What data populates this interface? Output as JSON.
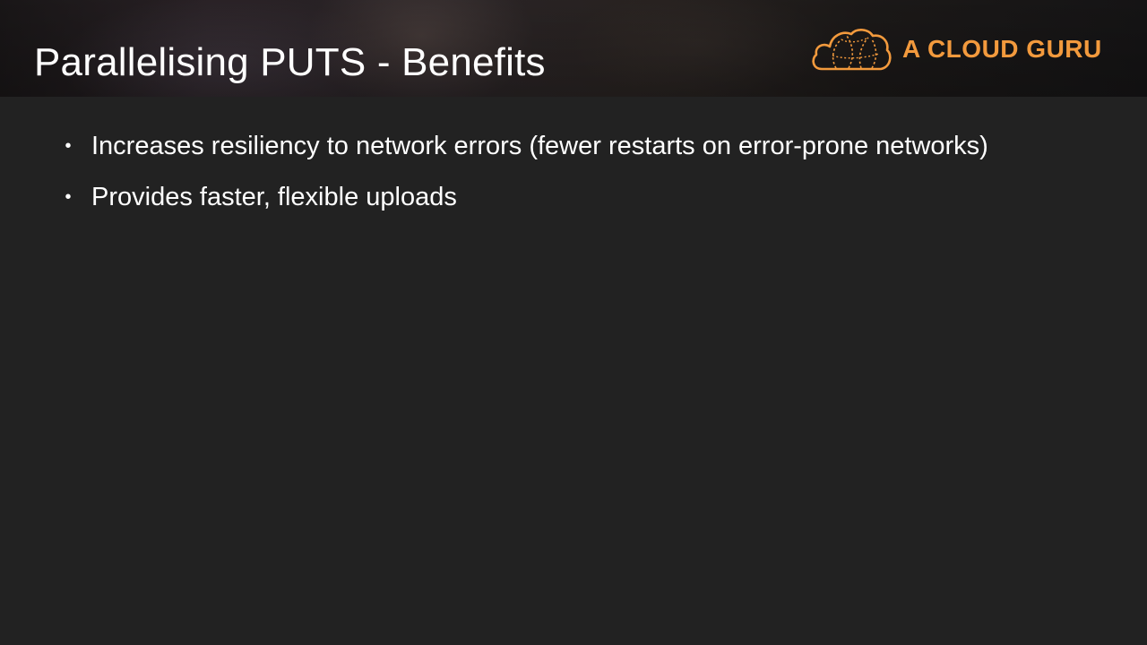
{
  "slide": {
    "title": "Parallelising PUTS - Benefits",
    "logo": {
      "icon": "cloud-logo-icon",
      "text": "A CLOUD GURU",
      "color": "#f39a3d"
    },
    "bullets": [
      {
        "text": "Increases resiliency to network errors (fewer restarts on error-prone networks)"
      },
      {
        "text": "Provides faster, flexible uploads"
      }
    ],
    "bullet_glyph": "•",
    "colors": {
      "background": "#222222",
      "text": "#ffffff",
      "accent": "#f39a3d"
    }
  }
}
